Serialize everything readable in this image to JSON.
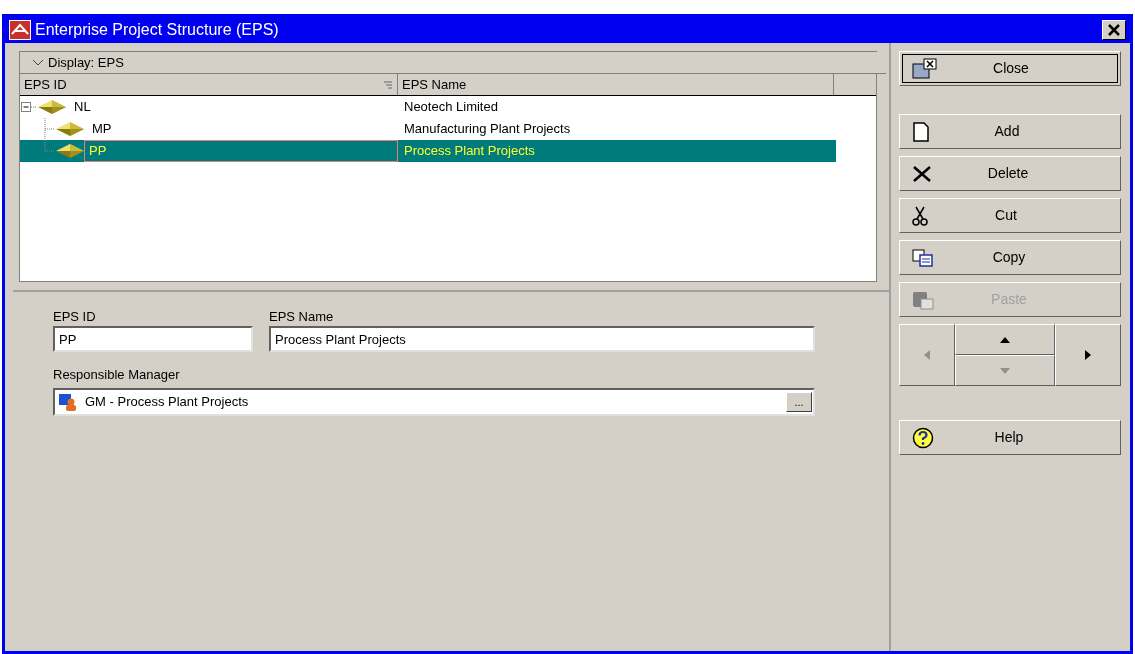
{
  "window": {
    "title": "Enterprise Project Structure (EPS)"
  },
  "display_bar": {
    "label": "Display: EPS"
  },
  "table": {
    "columns": [
      "EPS ID",
      "EPS Name"
    ],
    "rows": [
      {
        "id": "NL",
        "name": "Neotech Limited",
        "expanded": true,
        "selected": false,
        "children": [
          {
            "id": "MP",
            "name": "Manufacturing Plant Projects",
            "selected": false
          },
          {
            "id": "PP",
            "name": "Process Plant Projects",
            "selected": true
          }
        ]
      }
    ]
  },
  "form": {
    "eps_id_label": "EPS ID",
    "eps_id": "PP",
    "eps_name_label": "EPS Name",
    "eps_name": "Process Plant Projects",
    "manager_label": "Responsible Manager",
    "manager": "GM - Process Plant Projects",
    "browse": "..."
  },
  "buttons": [
    {
      "kind": "close",
      "label": "Close",
      "disabled": false
    },
    {
      "kind": "add",
      "label": "Add",
      "disabled": false
    },
    {
      "kind": "delete",
      "label": "Delete",
      "disabled": false
    },
    {
      "kind": "cut",
      "label": "Cut",
      "disabled": false
    },
    {
      "kind": "copy",
      "label": "Copy",
      "disabled": false
    },
    {
      "kind": "paste",
      "label": "Paste",
      "disabled": true
    },
    {
      "kind": "help",
      "label": "Help",
      "disabled": false
    }
  ],
  "move": {
    "left_disabled": true,
    "up_disabled": false,
    "down_disabled": true,
    "right_disabled": false
  }
}
